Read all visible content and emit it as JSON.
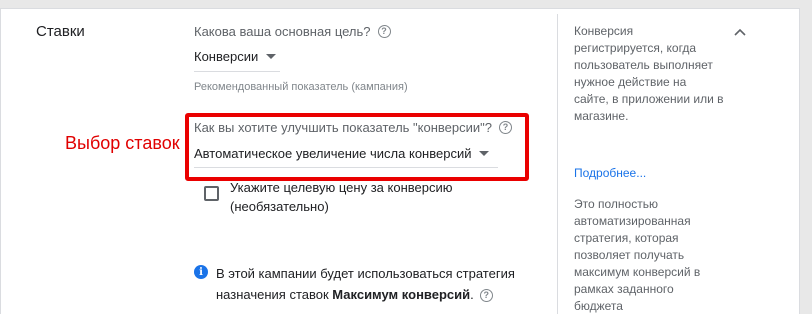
{
  "section": {
    "title": "Ставки"
  },
  "goal": {
    "question": "Какова ваша основная цель?",
    "selected": "Конверсии",
    "hint": "Рекомендованный показатель (кампания)"
  },
  "annotation": {
    "label": "Выбор ставок",
    "color": "#ea0000"
  },
  "bidding": {
    "question": "Как вы хотите улучшить показатель \"конверсии\"?",
    "selected": "Автоматическое увеличение числа конверсий",
    "target_checkbox_label": "Укажите целевую цену за конверсию (необязательно)",
    "target_checked": false
  },
  "info": {
    "text_before": "В этой кампании будет использоваться стратегия назначения ставок ",
    "strategy_name": "Максимум конверсий",
    "text_after": "."
  },
  "sidebar": {
    "paragraph1": "Конверсия регистрируется, когда пользователь выполняет нужное действие на сайте, в приложении или в магазине.",
    "link": "Подробнее...",
    "paragraph2": "Это полностью автоматизированная стратегия, которая позволяет получать максимум конверсий в рамках заданного бюджета"
  },
  "icons": {
    "help": "help-circle-icon",
    "dropdown": "caret-down-icon",
    "info": "info-icon",
    "collapse": "chevron-up-icon"
  },
  "colors": {
    "accent": "#1a73e8",
    "annotation": "#ea0000"
  }
}
